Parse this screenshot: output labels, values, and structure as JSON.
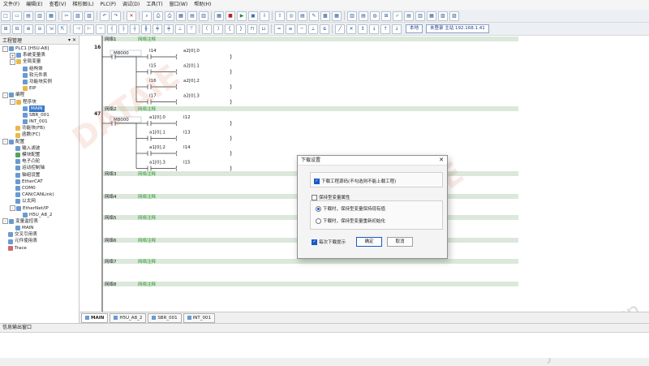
{
  "menu": [
    "文件(F)",
    "编辑(E)",
    "查看(V)",
    "梯形图(L)",
    "PLC(P)",
    "调试(D)",
    "工具(T)",
    "窗口(W)",
    "帮助(H)"
  ],
  "toolbar": {
    "local_label": "本地",
    "conn_status": "未登录 主站 192.168.1.41"
  },
  "sidebar": {
    "title": "工程管理",
    "pin": "▾ ✕",
    "items": [
      {
        "label": "PLC1 [H5U-A8]",
        "level": 0,
        "exp": "-",
        "icon": "b"
      },
      {
        "label": "系统变量表",
        "level": 1,
        "exp": "+",
        "icon": "b"
      },
      {
        "label": "全局变量",
        "level": 1,
        "exp": "-",
        "icon": "y"
      },
      {
        "label": "结构体",
        "level": 2,
        "exp": "",
        "icon": "b"
      },
      {
        "label": "软元件表",
        "level": 2,
        "exp": "",
        "icon": "b"
      },
      {
        "label": "功能块实例",
        "level": 2,
        "exp": "",
        "icon": "b"
      },
      {
        "label": "EIP",
        "level": 2,
        "exp": "",
        "icon": "y"
      },
      {
        "label": "编程",
        "level": 0,
        "exp": "-",
        "icon": "b"
      },
      {
        "label": "程序块",
        "level": 1,
        "exp": "-",
        "icon": "y"
      },
      {
        "label": "MAIN",
        "level": 2,
        "exp": "",
        "icon": "b",
        "selected": true
      },
      {
        "label": "SBR_001",
        "level": 2,
        "exp": "",
        "icon": "b"
      },
      {
        "label": "INT_001",
        "level": 2,
        "exp": "",
        "icon": "b"
      },
      {
        "label": "功能块(FB)",
        "level": 1,
        "exp": "",
        "icon": "y"
      },
      {
        "label": "函数(FC)",
        "level": 1,
        "exp": "",
        "icon": "y"
      },
      {
        "label": "配置",
        "level": 0,
        "exp": "-",
        "icon": "b"
      },
      {
        "label": "输入滤波",
        "level": 1,
        "exp": "",
        "icon": "b"
      },
      {
        "label": "模块配置",
        "level": 1,
        "exp": "",
        "icon": "g"
      },
      {
        "label": "电子凸轮",
        "level": 1,
        "exp": "",
        "icon": "b"
      },
      {
        "label": "运动控制轴",
        "level": 1,
        "exp": "",
        "icon": "b"
      },
      {
        "label": "轴组设置",
        "level": 1,
        "exp": "",
        "icon": "b"
      },
      {
        "label": "EtherCAT",
        "level": 1,
        "exp": "",
        "icon": "b"
      },
      {
        "label": "COM0",
        "level": 1,
        "exp": "",
        "icon": "b"
      },
      {
        "label": "CAN(CANLink)",
        "level": 1,
        "exp": "",
        "icon": "b"
      },
      {
        "label": "以太网",
        "level": 1,
        "exp": "",
        "icon": "b"
      },
      {
        "label": "EtherNet/IP",
        "level": 1,
        "exp": "-",
        "icon": "b"
      },
      {
        "label": "H5U_A8_2",
        "level": 2,
        "exp": "",
        "icon": "b"
      },
      {
        "label": "变量监控表",
        "level": 0,
        "exp": "-",
        "icon": "b"
      },
      {
        "label": "MAIN",
        "level": 1,
        "exp": "",
        "icon": "b"
      },
      {
        "label": "交叉引用表",
        "level": 0,
        "exp": "",
        "icon": "b"
      },
      {
        "label": "元件使用表",
        "level": 0,
        "exp": "",
        "icon": "b"
      },
      {
        "label": "Trace",
        "level": 0,
        "exp": "",
        "icon": "r"
      }
    ]
  },
  "networks": [
    {
      "label": "网络1",
      "comment": "网络注释",
      "step": "16"
    },
    {
      "label": "网络2",
      "comment": "网络注释",
      "step": "47"
    },
    {
      "label": "网络3",
      "comment": "网络注释"
    },
    {
      "label": "网络4",
      "comment": "网络注释"
    },
    {
      "label": "网络5",
      "comment": "网络注释"
    },
    {
      "label": "网络6",
      "comment": "网络注释"
    },
    {
      "label": "网络7",
      "comment": "网络注释"
    },
    {
      "label": "网络8",
      "comment": "网络注释"
    }
  ],
  "ladder": {
    "n1_contact": "M8000",
    "n1_inputs": [
      "I14",
      "I15",
      "I16",
      "I17"
    ],
    "n1_outputs": [
      "a2[0].0",
      "a2[0].1",
      "a2[0].2",
      "a2[0].3"
    ],
    "n2_contact": "M8000",
    "n2_inputs": [
      "a1[0].0",
      "a1[0].1",
      "a1[0].2",
      "a1[0].3"
    ],
    "n2_outputs": [
      "I12",
      "I13",
      "I14",
      "I15"
    ]
  },
  "tabs": [
    "MAIN",
    "H5U_A8_2",
    "SBR_001",
    "INT_001"
  ],
  "output": {
    "title": "信息输出窗口"
  },
  "dialog": {
    "title": "下载设置",
    "close": "✕",
    "download_source": "下载工程源码(不勾选则不能上载工程)",
    "retain_group": "保持型变量属性",
    "radio_keep": "下载时，保持型变量保持现有值",
    "radio_reinit": "下载时，保持型变量重新初始化",
    "remind": "每次下载提示",
    "ok": "确定",
    "cancel": "取消"
  },
  "watermark": {
    "a": "DATAIE",
    "b": "DATAIE",
    "site": "ybzhan.cn"
  }
}
